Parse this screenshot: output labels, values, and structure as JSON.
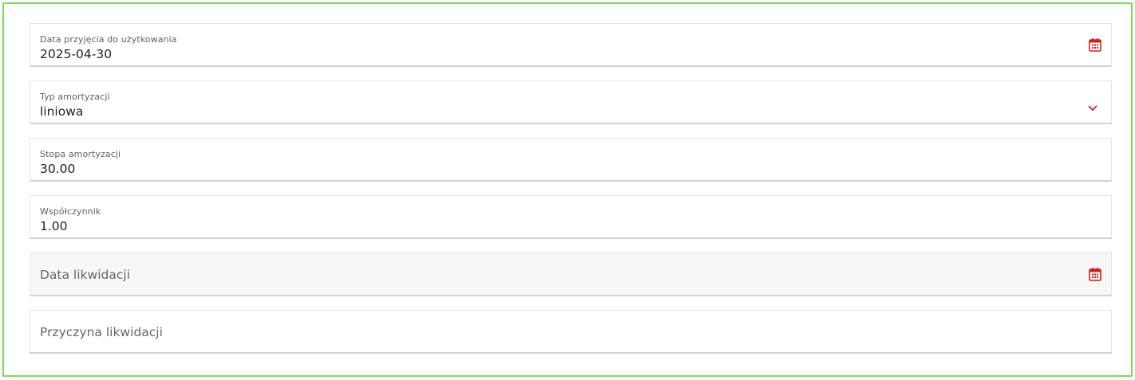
{
  "form": {
    "fields": [
      {
        "label": "Data przyjęcia do użytkowania",
        "value": "2025-04-30",
        "icon": "calendar-icon"
      },
      {
        "label": "Typ amortyzacji",
        "value": "liniowa",
        "icon": "chevron-down-icon"
      },
      {
        "label": "Stopa amortyzacji",
        "value": "30.00"
      },
      {
        "label": "Współczynnik",
        "value": "1.00"
      },
      {
        "placeholder": "Data likwidacji",
        "icon": "calendar-icon"
      },
      {
        "placeholder": "Przyczyna likwidacji"
      }
    ]
  },
  "colors": {
    "frame_border": "#7ed957",
    "icon_accent": "#cc1f1f",
    "field_border": "#d2d2d2",
    "disabled_bg": "#f7f7f7"
  }
}
